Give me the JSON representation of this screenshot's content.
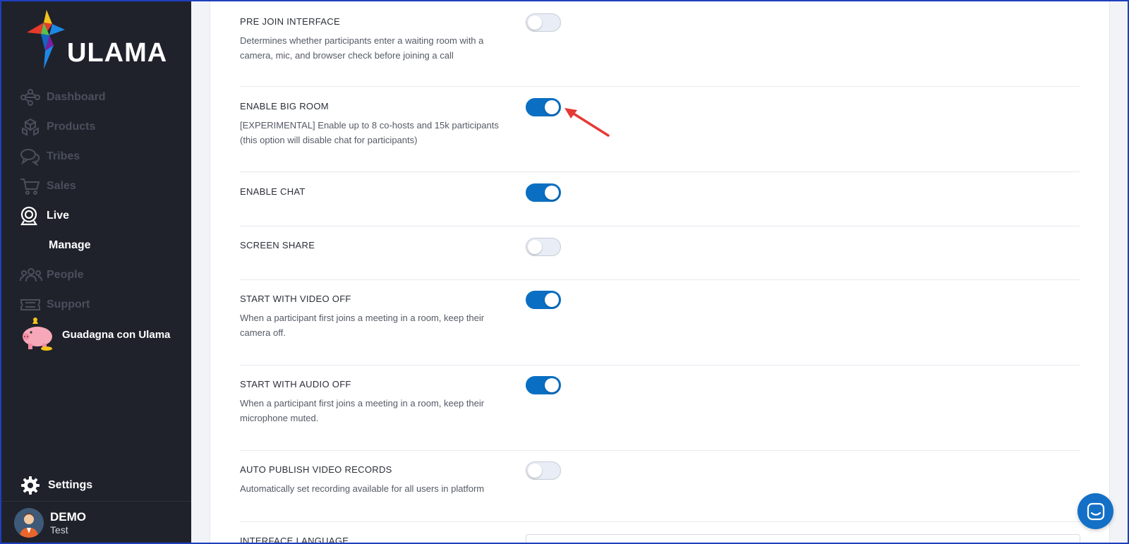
{
  "brand": {
    "name": "ULAMA"
  },
  "sidebar": {
    "items": [
      {
        "label": "Dashboard",
        "icon": "network-icon",
        "active": false
      },
      {
        "label": "Products",
        "icon": "boxes-icon",
        "active": false
      },
      {
        "label": "Tribes",
        "icon": "chat-bubbles-icon",
        "active": false
      },
      {
        "label": "Sales",
        "icon": "cart-icon",
        "active": false
      },
      {
        "label": "Live",
        "icon": "webcam-icon",
        "active": true
      },
      {
        "label": "People",
        "icon": "people-icon",
        "active": false
      },
      {
        "label": "Support",
        "icon": "ticket-icon",
        "active": false
      }
    ],
    "live_sub": "Manage",
    "promo_label": "Guadagna con Ulama",
    "settings_label": "Settings",
    "user": {
      "name": "DEMO",
      "subtitle": "Test"
    }
  },
  "settings": [
    {
      "title": "PRE JOIN INTERFACE",
      "description": "Determines whether participants enter a waiting room with a camera, mic, and browser check before joining a call",
      "enabled": false
    },
    {
      "title": "ENABLE BIG ROOM",
      "description": "[EXPERIMENTAL] Enable up to 8 co-hosts and 15k participants (this option will disable chat for participants)",
      "enabled": true
    },
    {
      "title": "ENABLE CHAT",
      "description": "",
      "enabled": true
    },
    {
      "title": "SCREEN SHARE",
      "description": "",
      "enabled": false
    },
    {
      "title": "START WITH VIDEO OFF",
      "description": "When a participant first joins a meeting in a room, keep their camera off.",
      "enabled": true
    },
    {
      "title": "START WITH AUDIO OFF",
      "description": "When a participant first joins a meeting in a room, keep their microphone muted.",
      "enabled": true
    },
    {
      "title": "AUTO PUBLISH VIDEO RECORDS",
      "description": "Automatically set recording available for all users in platform",
      "enabled": false
    },
    {
      "title": "INTERFACE LANGUAGE",
      "description": "",
      "enabled": null
    }
  ],
  "colors": {
    "sidebar_bg": "#1f222b",
    "accent": "#0a6fc2",
    "annotation_arrow": "#e53935"
  }
}
